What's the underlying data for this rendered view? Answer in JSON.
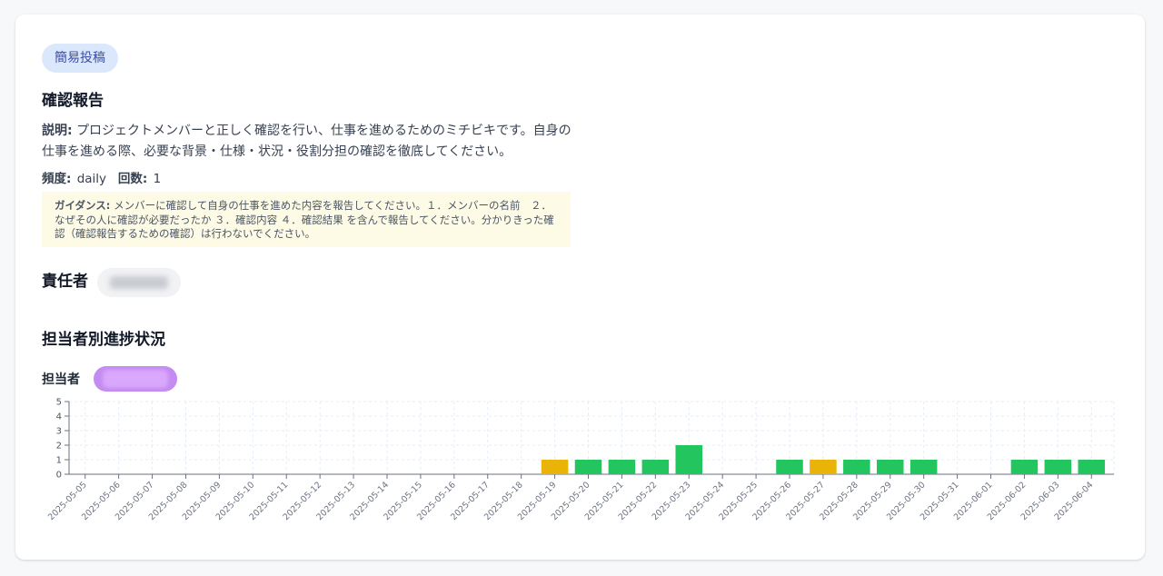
{
  "task": {
    "badge": "簡易投稿",
    "title": "確認報告",
    "description_label": "説明:",
    "description": "プロジェクトメンバーと正しく確認を行い、仕事を進めるためのミチビキです。自身の仕事を進める際、必要な背景・仕様・状況・役割分担の確認を徹底してください。",
    "frequency_label": "頻度:",
    "frequency": "daily",
    "count_label": "回数:",
    "count": "1",
    "guidance_label": "ガイダンス:",
    "guidance": "メンバーに確認して自身の仕事を進めた内容を報告してください。１．メンバーの名前　２．なぜその人に確認が必要だったか ３．確認内容 ４．確認結果 を含んで報告してください。分かりきった確認（確認報告するための確認）は行わないでください。"
  },
  "owner": {
    "label": "責任者"
  },
  "progress": {
    "title": "担当者別進捗状況",
    "assignee_label": "担当者"
  },
  "colors": {
    "complete": "#22c55e",
    "partial": "#eab308",
    "grid": "#e6ecf5"
  },
  "chart_data": {
    "type": "bar",
    "categories": [
      "2025-05-05",
      "2025-05-06",
      "2025-05-07",
      "2025-05-08",
      "2025-05-09",
      "2025-05-10",
      "2025-05-11",
      "2025-05-12",
      "2025-05-13",
      "2025-05-14",
      "2025-05-15",
      "2025-05-16",
      "2025-05-17",
      "2025-05-18",
      "2025-05-19",
      "2025-05-20",
      "2025-05-21",
      "2025-05-22",
      "2025-05-23",
      "2025-05-24",
      "2025-05-25",
      "2025-05-26",
      "2025-05-27",
      "2025-05-28",
      "2025-05-29",
      "2025-05-30",
      "2025-05-31",
      "2025-06-01",
      "2025-06-02",
      "2025-06-03",
      "2025-06-04"
    ],
    "values": [
      0,
      0,
      0,
      0,
      0,
      0,
      0,
      0,
      0,
      0,
      0,
      0,
      0,
      0,
      1,
      1,
      1,
      1,
      2,
      0,
      0,
      1,
      1,
      1,
      1,
      1,
      0,
      0,
      1,
      1,
      1
    ],
    "bar_status": [
      "",
      "",
      "",
      "",
      "",
      "",
      "",
      "",
      "",
      "",
      "",
      "",
      "",
      "",
      "partial",
      "complete",
      "complete",
      "complete",
      "complete",
      "",
      "",
      "complete",
      "partial",
      "complete",
      "complete",
      "complete",
      "",
      "",
      "complete",
      "complete",
      "complete"
    ],
    "yticks": [
      0,
      1,
      2,
      3,
      4,
      5
    ],
    "ylim": [
      0,
      5
    ],
    "grid": true,
    "xlabel": "",
    "ylabel": ""
  }
}
